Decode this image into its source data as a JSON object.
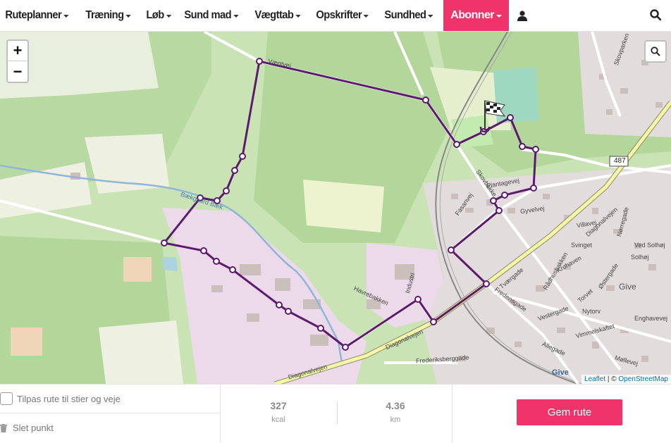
{
  "nav": {
    "items": [
      {
        "label": "Ruteplanner",
        "name": "nav-ruteplanner"
      },
      {
        "label": "Træning",
        "name": "nav-traening"
      },
      {
        "label": "Løb",
        "name": "nav-lob"
      },
      {
        "label": "Sund mad",
        "name": "nav-sund-mad"
      },
      {
        "label": "Vægttab",
        "name": "nav-vaegttab"
      },
      {
        "label": "Opskrifter",
        "name": "nav-opskrifter"
      },
      {
        "label": "Sundhed",
        "name": "nav-sundhed"
      }
    ],
    "active": {
      "label": "Abonner"
    }
  },
  "map": {
    "zoom_in": "+",
    "zoom_out": "−",
    "attribution_leaflet": "Leaflet",
    "attribution_sep": " | © ",
    "attribution_osm": "OpenStreetMap",
    "labels": {
      "vaegtvej": "Vægtvej",
      "baek": "Bækgaard Bæk",
      "diagonal1": "Diagonalvejen",
      "diagonal2": "Diagonalvejen",
      "diagonal3": "Diagonalvejen",
      "havrebakken": "Havrebakken",
      "industri": "Industri",
      "frederiksberggade": "Frederiksberggade",
      "skovbakke": "Skovbakke",
      "plantagevej": "Plantagevej",
      "fasanvej": "Fasanvej",
      "gyvelvej": "Gyvelvej",
      "villavej": "Villavej",
      "svinget": "Svinget",
      "vedsolhoj": "Ved Solhøj",
      "solhoj": "Solhøj",
      "noerregade": "Nørregade",
      "give": "Give",
      "give2": "Give",
      "r487": "487",
      "skovparken": "Skovparken",
      "tvaergade": "Tværgade",
      "fredensgade": "Fredensgade",
      "raadhus": "Rådhusbakken",
      "vestergade": "Vestergade",
      "torvet": "Torvet",
      "nytorv": "Nytorv",
      "vimmel": "Vimmelskaftet",
      "enghave": "Enghavevej",
      "moellevej": "Møllevej",
      "allegade": "Allegade",
      "krohaven": "Krohaven",
      "oestergade": "Østergade"
    }
  },
  "options": {
    "fit_route": "Tilpas rute til stier og veje",
    "delete_point": "Slet punkt"
  },
  "stats": {
    "kcal_value": "327",
    "kcal_unit": "kcal",
    "km_value": "4.36",
    "km_unit": "km"
  },
  "save_label": "Gem rute",
  "colors": {
    "accent": "#f0336b",
    "route": "#5c1a6e"
  }
}
